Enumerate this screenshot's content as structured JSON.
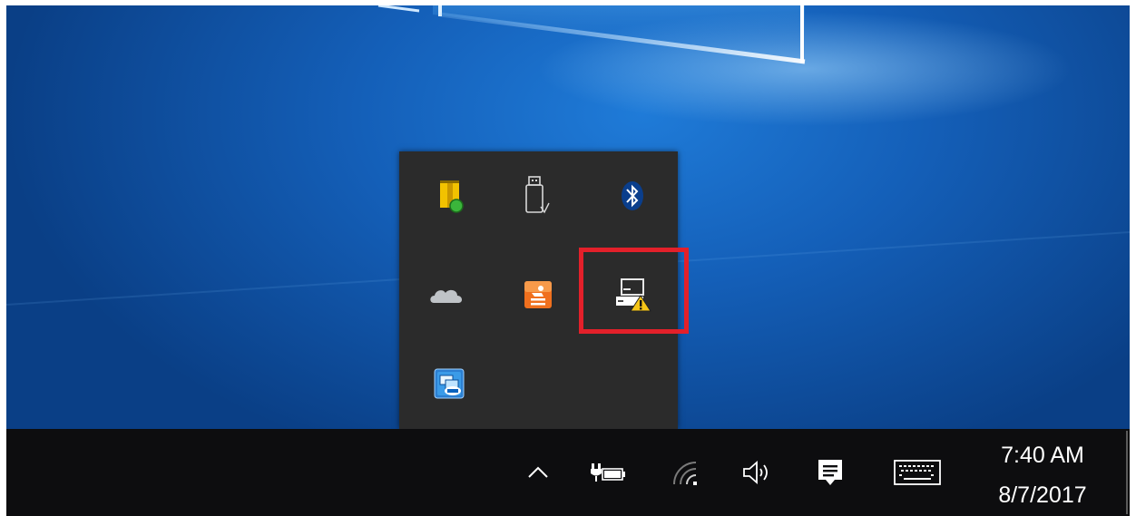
{
  "taskbar": {
    "clock": {
      "time": "7:40 AM",
      "date": "8/7/2017"
    },
    "icons": [
      "chevron-up-icon",
      "battery-plug-icon",
      "wifi-icon",
      "volume-icon",
      "action-center-icon",
      "touch-keyboard-icon"
    ]
  },
  "tray_popup": {
    "icons": [
      "security-shield-icon",
      "usb-safely-remove-icon",
      "bluetooth-icon",
      "onedrive-icon",
      "orange-app-icon",
      "network-warning-icon",
      "intel-graphics-icon"
    ],
    "highlighted": "network-warning-icon"
  },
  "colors": {
    "highlight": "#e3202a",
    "taskbar": "#0d0d0f",
    "popup": "#2b2b2b"
  }
}
